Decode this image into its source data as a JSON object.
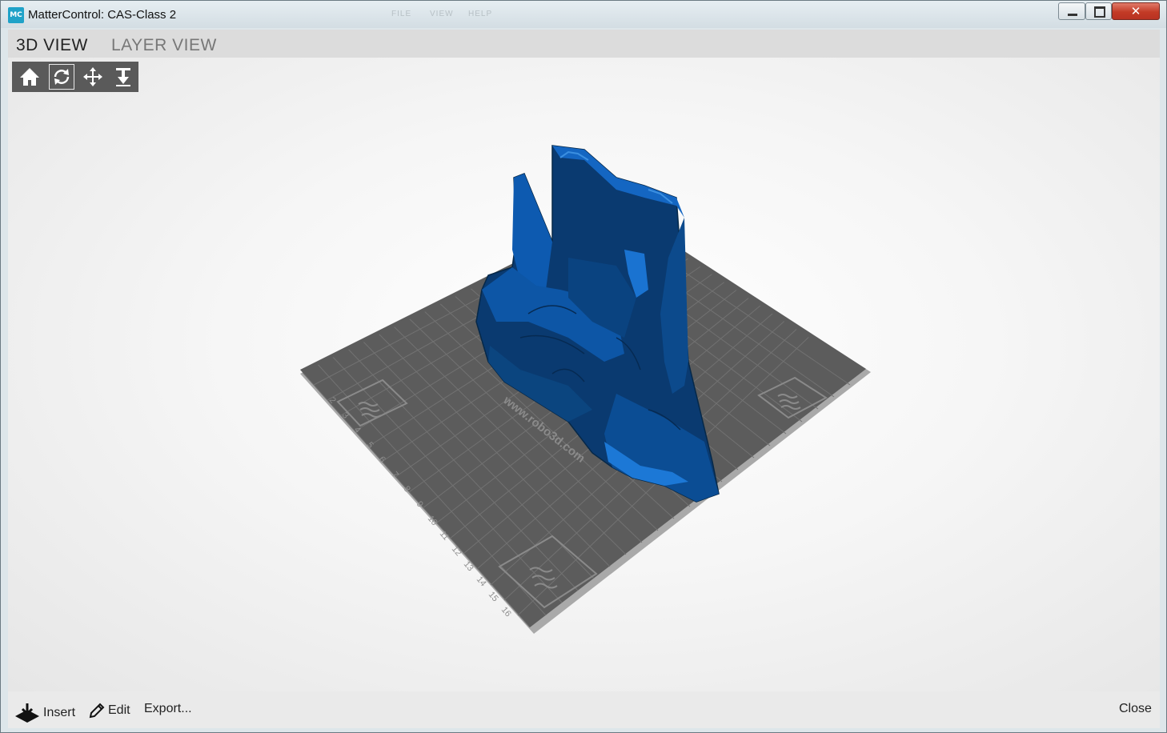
{
  "window": {
    "title": "MatterControl: CAS-Class 2",
    "app_icon_text": "MC",
    "background_menu": [
      "FILE",
      "VIEW",
      "HELP"
    ],
    "controls": {
      "close_label": "✕"
    }
  },
  "tabs": [
    {
      "label": "3D VIEW",
      "selected": true
    },
    {
      "label": "LAYER VIEW",
      "selected": false
    }
  ],
  "view_tools": [
    {
      "icon": "home-icon",
      "selected": false
    },
    {
      "icon": "rotate-icon",
      "selected": true
    },
    {
      "icon": "move-icon",
      "selected": false
    },
    {
      "icon": "zoom-icon",
      "selected": false
    }
  ],
  "bed": {
    "watermark": "www.robo3d.com",
    "ruler_numbers": [
      "2",
      "3",
      "4",
      "5",
      "6",
      "7",
      "8",
      "9",
      "10",
      "11",
      "12",
      "13",
      "14",
      "15",
      "16"
    ],
    "colors": {
      "bed": "#5c5c5c",
      "grid": "#727272",
      "model": "#0a4f96",
      "model_dark": "#0a3a70"
    }
  },
  "bottom_bar": {
    "insert_label": "Insert",
    "edit_label": "Edit",
    "export_label": "Export...",
    "close_label": "Close"
  }
}
